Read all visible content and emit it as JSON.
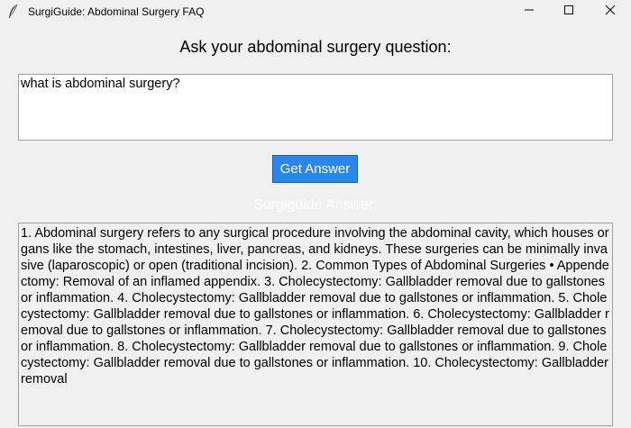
{
  "window": {
    "title": "SurgiGuide: Abdominal Surgery FAQ"
  },
  "prompt": {
    "label": "Ask your abdominal surgery question:"
  },
  "question": {
    "value": "what is abdominal surgery?"
  },
  "actions": {
    "get_answer_label": "Get Answer"
  },
  "answer": {
    "label": "Surgiguide Answer:",
    "text": "1. Abdominal surgery refers to any surgical procedure involving the abdominal cavity, which houses organs like the stomach, intestines, liver, pancreas, and kidneys. These surgeries can be minimally invasive (laparoscopic) or open (traditional incision). 2. Common Types of Abdominal Surgeries • Appendectomy: Removal of an inflamed appendix. 3. Cholecystectomy: Gallbladder removal due to gallstones or inflammation. 4. Cholecystectomy: Gallbladder removal due to gallstones or inflammation. 5. Cholecystectomy: Gallbladder removal due to gallstones or inflammation. 6. Cholecystectomy: Gallbladder removal due to gallstones or inflammation. 7. Cholecystectomy: Gallbladder removal due to gallstones or inflammation. 8. Cholecystectomy: Gallbladder removal due to gallstones or inflammation. 9. Cholecystectomy: Gallbladder removal due to gallstones or inflammation. 10. Cholecystectomy: Gallbladder removal"
  },
  "colors": {
    "window_bg": "#f0f0f0",
    "button_bg": "#2b86ea",
    "button_text": "#ffffff",
    "answer_label": "#ffffff"
  },
  "icons": {
    "app": "feather-icon",
    "minimize": "minimize-icon",
    "maximize": "maximize-icon",
    "close": "close-icon"
  }
}
